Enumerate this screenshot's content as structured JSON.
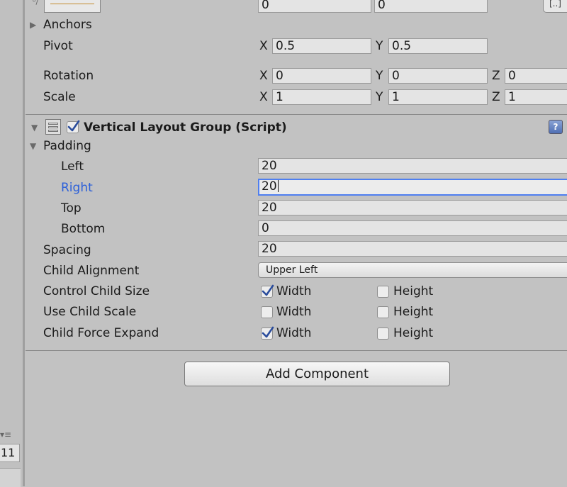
{
  "rect_transform": {
    "top_left_value": "0",
    "top_right_value": "0",
    "anchors_label": "Anchors",
    "pivot": {
      "label": "Pivot",
      "x_axis": "X",
      "x": "0.5",
      "y_axis": "Y",
      "y": "0.5"
    },
    "rotation": {
      "label": "Rotation",
      "x_axis": "X",
      "x": "0",
      "y_axis": "Y",
      "y": "0",
      "z_axis": "Z",
      "z": "0"
    },
    "scale": {
      "label": "Scale",
      "x_axis": "X",
      "x": "1",
      "y_axis": "Y",
      "y": "1",
      "z_axis": "Z",
      "z": "1"
    }
  },
  "component": {
    "title": "Vertical Layout Group (Script)",
    "enabled": true,
    "padding_label": "Padding",
    "padding": {
      "left_label": "Left",
      "left": "20",
      "right_label": "Right",
      "right": "20",
      "top_label": "Top",
      "top": "20",
      "bottom_label": "Bottom",
      "bottom": "0"
    },
    "spacing_label": "Spacing",
    "spacing": "20",
    "child_alignment_label": "Child Alignment",
    "child_alignment": "Upper Left",
    "control_child_size": {
      "label": "Control Child Size",
      "width_label": "Width",
      "width": true,
      "height_label": "Height",
      "height": false
    },
    "use_child_scale": {
      "label": "Use Child Scale",
      "width_label": "Width",
      "width": false,
      "height_label": "Height",
      "height": false
    },
    "child_force_expand": {
      "label": "Child Force Expand",
      "width_label": "Width",
      "width": true,
      "height_label": "Height",
      "height": false
    }
  },
  "add_component_label": "Add Component",
  "left_panel": {
    "value": "11"
  },
  "colors": {
    "focus": "#4f7ff0",
    "active_label": "#2b5fd9",
    "check": "#2a4c9c"
  }
}
